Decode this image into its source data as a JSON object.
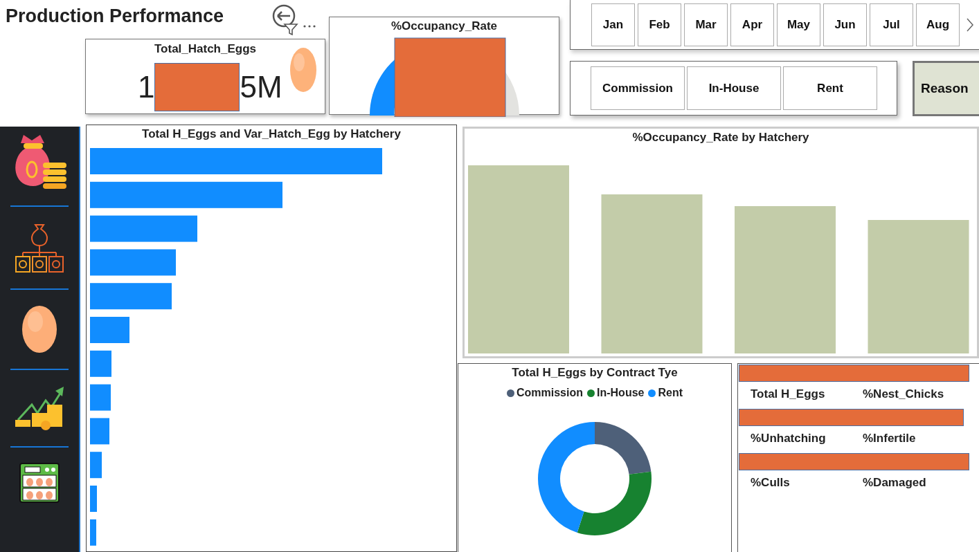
{
  "header": {
    "title": "Production Performance"
  },
  "kpi": {
    "title": "Total_Hatch_Eggs",
    "value_start": "1",
    "value_end": "5M"
  },
  "gauge": {
    "title": "%Occupancy_Rate"
  },
  "month_slicer": {
    "items": [
      "Jan",
      "Feb",
      "Mar",
      "Apr",
      "May",
      "Jun",
      "Jul",
      "Aug"
    ]
  },
  "contract_slicer": {
    "items": [
      "Commission",
      "In-House",
      "Rent"
    ]
  },
  "reason_button": {
    "label": "Reason"
  },
  "hatchery_bar_chart": {
    "title": "Total H_Eggs and Var_Hatch_Egg by Hatchery"
  },
  "occupancy_chart": {
    "title": "%Occupancy_Rate by Hatchery"
  },
  "contract_donut": {
    "title": "Total H_Eggs by Contract Tye",
    "legend": [
      {
        "label": "Commission",
        "color": "#4e6079"
      },
      {
        "label": "In-House",
        "color": "#178230"
      },
      {
        "label": "Rent",
        "color": "#118dff"
      }
    ]
  },
  "cards": {
    "rows": [
      {
        "left": "Total H_Eggs",
        "right": "%Nest_Chicks"
      },
      {
        "left": "%Unhatching",
        "right": "%Infertile"
      },
      {
        "left": "%Culls",
        "right": "%Damaged"
      }
    ]
  }
}
